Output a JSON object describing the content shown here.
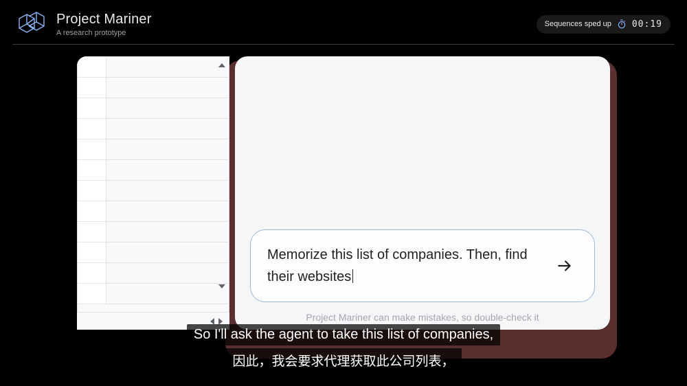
{
  "header": {
    "title": "Project Mariner",
    "subtitle": "A research prototype",
    "timerLabel": "Sequences sped up",
    "timerValue": "00:19"
  },
  "prompt": {
    "text": "Memorize this list of companies. Then, find their websites"
  },
  "disclaimer": "Project Mariner can make mistakes, so double-check it",
  "subtitles": {
    "en": "So I'll ask the agent to take this list of companies,",
    "zh": "因此，我会要求代理获取此公司列表，"
  }
}
